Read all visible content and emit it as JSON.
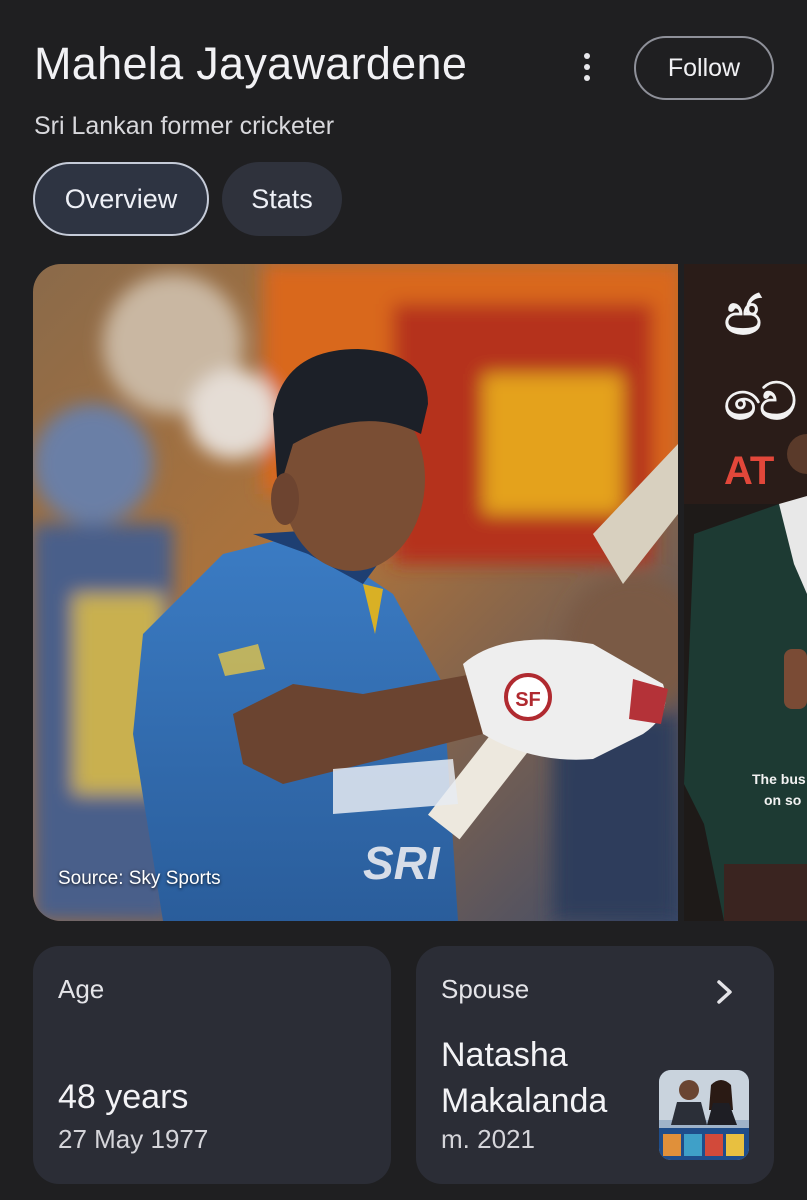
{
  "header": {
    "title": "Mahela Jayawardene",
    "subtitle": "Sri Lankan former cricketer",
    "more_icon": "more-vert-icon",
    "follow_label": "Follow"
  },
  "tabs": [
    {
      "label": "Overview",
      "selected": true
    },
    {
      "label": "Stats",
      "selected": false
    }
  ],
  "images": {
    "main_source": "Source: Sky Sports",
    "side_text_line1": "ජ",
    "side_text_line2": "වෙ",
    "side_text_line3": "AT",
    "side_caption_line1": "The bus",
    "side_caption_line2": "on so",
    "jersey_text": "SRI",
    "glove_logo": "SF"
  },
  "facts": {
    "age": {
      "label": "Age",
      "value": "48 years",
      "sub": "27 May 1977"
    },
    "spouse": {
      "label": "Spouse",
      "name": "Natasha Makalanda",
      "sub": "m. 2021",
      "icon": "chevron-right-icon"
    }
  },
  "colors": {
    "background": "#1f1f21",
    "card": "#2b2d36",
    "tab_selected": "#2e3442",
    "tab": "#2f323c",
    "jersey_blue": "#2f6fb3"
  }
}
